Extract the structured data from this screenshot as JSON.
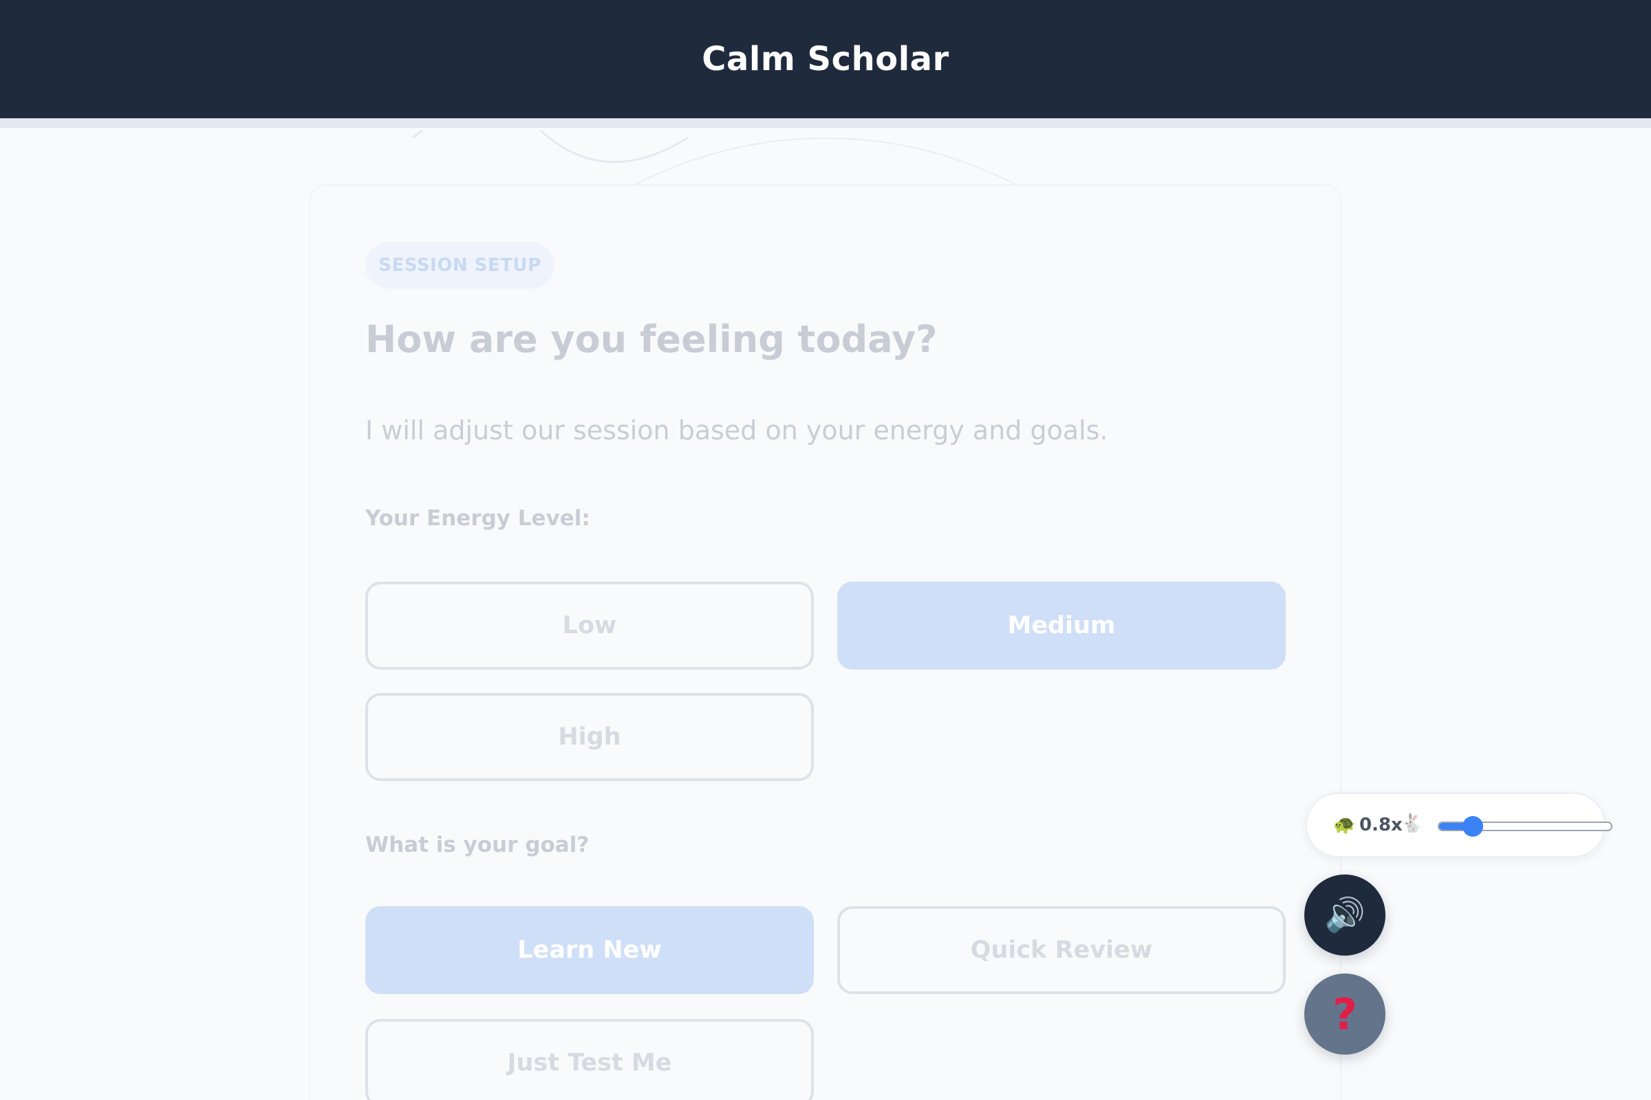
{
  "header": {
    "title": "Calm Scholar"
  },
  "session": {
    "badge": "SESSION SETUP",
    "headline": "How are you feeling today?",
    "subtext": "I will adjust our session based on your energy and goals.",
    "energy_label": "Your Energy Level:",
    "energy_options": [
      {
        "label": "Low",
        "selected": false
      },
      {
        "label": "Medium",
        "selected": true
      },
      {
        "label": "High",
        "selected": false
      }
    ],
    "goal_label": "What is your goal?",
    "goal_options": [
      {
        "label": "Learn New",
        "selected": true
      },
      {
        "label": "Quick Review",
        "selected": false
      },
      {
        "label": "Just Test Me",
        "selected": false
      }
    ]
  },
  "speed_control": {
    "slow_icon": "turtle-icon",
    "fast_icon": "rabbit-icon",
    "value_text": "0.8x",
    "level": 0.2
  },
  "fab": {
    "audio_icon": "speaker-icon",
    "help_icon": "question-mark-icon"
  },
  "colors": {
    "header_bg": "#1f2a3d",
    "accent": "#3b82f6",
    "selected_option": "#cfdff7",
    "help_button": "#64748b"
  }
}
